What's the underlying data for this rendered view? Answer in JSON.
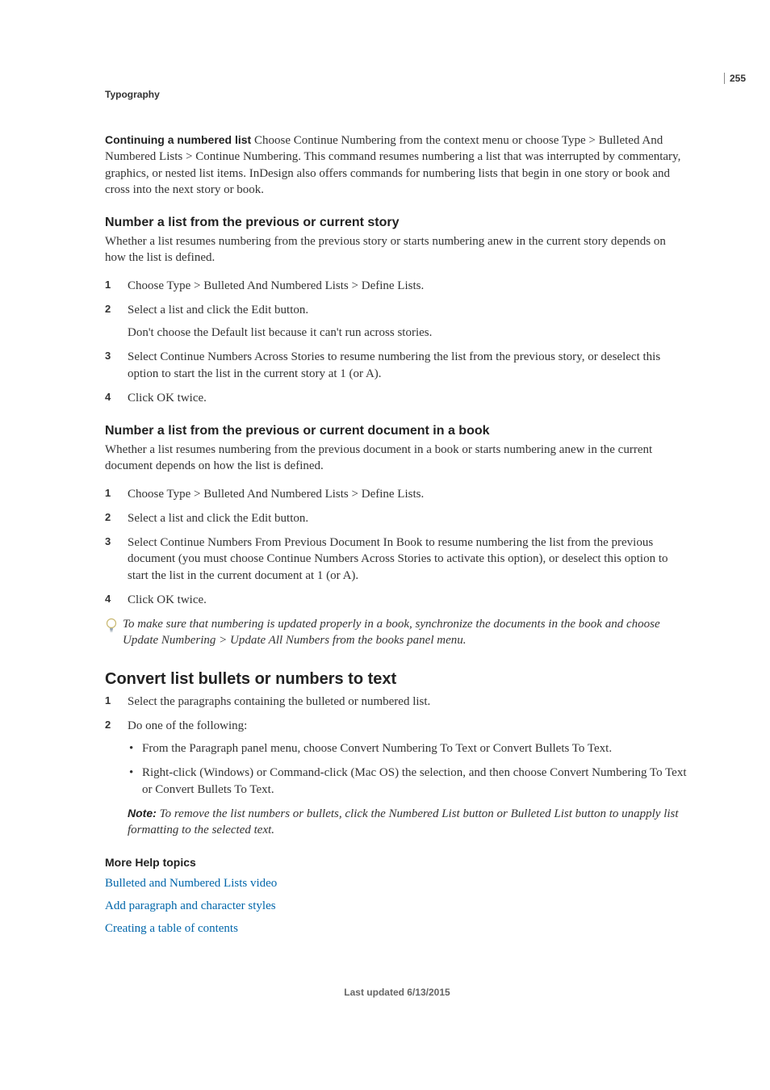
{
  "page_number": "255",
  "section_header": "Typography",
  "para1": {
    "lead": "Continuing a numbered list",
    "text": "  Choose Continue Numbering from the context menu or choose Type > Bulleted And Numbered Lists > Continue Numbering. This command resumes numbering a list that was interrupted by commentary, graphics, or nested list items. InDesign also offers commands for numbering lists that begin in one story or book and cross into the next story or book."
  },
  "h3_1": "Number a list from the previous or current story",
  "h3_1_intro": "Whether a list resumes numbering from the previous story or starts numbering anew in the current story depends on how the list is defined.",
  "h3_1_steps": [
    {
      "n": "1",
      "text": "Choose Type > Bulleted And Numbered Lists > Define Lists."
    },
    {
      "n": "2",
      "text": "Select a list and click the Edit button.",
      "sub": "Don't choose the Default list because it can't run across stories."
    },
    {
      "n": "3",
      "text": "Select Continue Numbers Across Stories to resume numbering the list from the previous story, or deselect this option to start the list in the current story at 1 (or A)."
    },
    {
      "n": "4",
      "text": "Click OK twice."
    }
  ],
  "h3_2": "Number a list from the previous or current document in a book",
  "h3_2_intro": "Whether a list resumes numbering from the previous document in a book or starts numbering anew in the current document depends on how the list is defined.",
  "h3_2_steps": [
    {
      "n": "1",
      "text": "Choose Type > Bulleted And Numbered Lists > Define Lists."
    },
    {
      "n": "2",
      "text": "Select a list and click the Edit button."
    },
    {
      "n": "3",
      "text": "Select Continue Numbers From Previous Document In Book to resume numbering the list from the previous document (you must choose Continue Numbers Across Stories to activate this option), or deselect this option to start the list in the current document at 1 (or A)."
    },
    {
      "n": "4",
      "text": "Click OK twice."
    }
  ],
  "tip_1": "To make sure that numbering is updated properly in a book, synchronize the documents in the book and choose Update Numbering > Update All Numbers from the books panel menu.",
  "h2_1": "Convert list bullets or numbers to text",
  "h2_1_steps": [
    {
      "n": "1",
      "text": "Select the paragraphs containing the bulleted or numbered list."
    },
    {
      "n": "2",
      "text": "Do one of the following:"
    }
  ],
  "h2_1_bullets": [
    "From the Paragraph panel menu, choose Convert Numbering To Text or Convert Bullets To Text.",
    "Right-click (Windows) or Command-click (Mac OS) the selection, and then choose Convert Numbering To Text or Convert Bullets To Text."
  ],
  "note_label": "Note: ",
  "note_text": "To remove the list numbers or bullets, click the Numbered List button or Bulleted List button to unapply list formatting to the selected text.",
  "more_help_title": "More Help topics",
  "links": [
    "Bulleted and Numbered Lists video",
    "Add paragraph and character styles",
    "Creating a table of contents"
  ],
  "footer": "Last updated 6/13/2015"
}
